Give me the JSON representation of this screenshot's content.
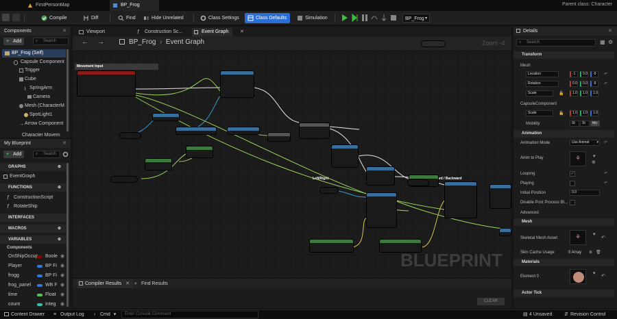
{
  "tabs": [
    {
      "label": "FirstPersonMap"
    },
    {
      "label": "BP_Frog"
    }
  ],
  "parent_class": "Parent class: Character",
  "toolbar": {
    "compile": "Compile",
    "diff": "Diff",
    "find": "Find",
    "hide_unrelated": "Hide Unrelated",
    "class_settings": "Class Settings",
    "class_defaults": "Class Defaults",
    "simulation": "Simulation",
    "debug_object": "BP_Frog"
  },
  "components": {
    "title": "Components",
    "add": "Add",
    "search_placeholder": "Search",
    "items": [
      {
        "label": "BP_Frog (Self)"
      },
      {
        "label": "Capsule Component"
      },
      {
        "label": "Trigger"
      },
      {
        "label": "Cube"
      },
      {
        "label": "SpringArm"
      },
      {
        "label": "Camera"
      },
      {
        "label": "Mesh (CharacterM"
      },
      {
        "label": "SpotLight1"
      },
      {
        "label": "Arrow Component"
      },
      {
        "label": "Character Movem"
      }
    ]
  },
  "my_blueprint": {
    "title": "My Blueprint",
    "add": "Add",
    "search_placeholder": "Search",
    "graphs": "GRAPHS",
    "event_graph": "EventGraph",
    "functions": "FUNCTIONS",
    "func_items": [
      {
        "label": "ConstructionScript"
      },
      {
        "label": "RotateShip"
      }
    ],
    "interfaces": "INTERFACES",
    "macros": "MACROS",
    "variables": "VARIABLES",
    "var_category": "Components",
    "vars": [
      {
        "name": "OnShipOccup",
        "type": "Boole",
        "color": "#8b0000"
      },
      {
        "name": "Player",
        "type": "BP Fi",
        "color": "#2f7bd8"
      },
      {
        "name": "frogg",
        "type": "BP Fi",
        "color": "#2f7bd8"
      },
      {
        "name": "frog_panel",
        "type": "WB F",
        "color": "#2f7bd8"
      },
      {
        "name": "time",
        "type": "Float",
        "color": "#4ec94e"
      },
      {
        "name": "count",
        "type": "Integ",
        "color": "#2ec4a4"
      }
    ]
  },
  "graph": {
    "tabs": [
      {
        "label": "Viewport"
      },
      {
        "label": "Construction Sc..."
      },
      {
        "label": "Event Graph"
      }
    ],
    "breadcrumb_bp": "BP_Frog",
    "breadcrumb_graph": "Event Graph",
    "zoom": "Zoom -4",
    "watermark": "BLUEPRINT",
    "comments": {
      "movement": "Movement Input",
      "left_right": "Left/Right",
      "forward_backward": "Forward / Backward"
    }
  },
  "bottom": {
    "compiler_results": "Compiler Results",
    "find_results": "Find Results",
    "clear": "CLEAR"
  },
  "details": {
    "title": "Details",
    "search_placeholder": "Search",
    "transform": "Transform",
    "mesh_label": "Mesh",
    "location": "Location",
    "rotation": "Rotation",
    "scale": "Scale",
    "loc_vals": [
      "-1",
      "0.0",
      "-9"
    ],
    "rot_vals": [
      "0.0",
      "0.0",
      "-9"
    ],
    "scale_vals": [
      "1.0",
      "1.0",
      "1.0"
    ],
    "capsule_component": "CapsuleComponent",
    "capsule_scale": "Scale",
    "capsule_scale_vals": [
      "1.0",
      "1.0",
      "1.0"
    ],
    "mobility": "Mobility",
    "mobility_options": [
      "St",
      "St",
      "Mo"
    ],
    "animation": "Animation",
    "animation_mode": "Animation Mode",
    "animation_mode_val": "Use Animat",
    "anim_to_play": "Anim to Play",
    "looping": "Looping",
    "playing": "Playing",
    "initial_position": "Initial Position",
    "initial_position_val": "0.0",
    "disable_post": "Disable Post Process Bl...",
    "advanced": "Advanced",
    "mesh_section": "Mesh",
    "skeletal_mesh_asset": "Skeletal Mesh Asset",
    "skin_cache": "Skin Cache Usage",
    "skin_cache_val": "0 Array",
    "materials": "Materials",
    "element0": "Element 0",
    "actor_tick": "Actor Tick"
  },
  "status": {
    "content_drawer": "Content Drawer",
    "output_log": "Output Log",
    "cmd": "Cmd",
    "console_placeholder": "Enter Console Command",
    "unsaved": "4 Unsaved",
    "revision": "Revision Control"
  }
}
